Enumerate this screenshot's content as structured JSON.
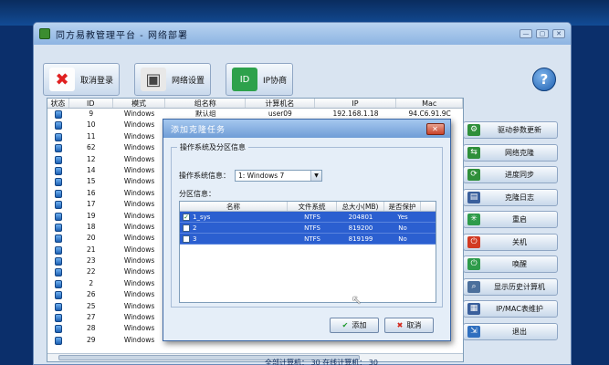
{
  "window": {
    "title": "同方易教管理平台 - 网络部署"
  },
  "toolbar": {
    "logout_label": "取消登录",
    "network_label": "网络设置",
    "ip_label": "IP协商",
    "ip_badge": "ID",
    "help_label": "?"
  },
  "table": {
    "headers": [
      "状态",
      "ID",
      "模式",
      "组名称",
      "计算机名",
      "IP",
      "Mac"
    ],
    "rows": [
      {
        "id": "9",
        "mode": "Windows",
        "group": "默认组",
        "pc": "user09",
        "ip": "192.168.1.18",
        "mac": "94.C6.91.9C"
      },
      {
        "id": "10",
        "mode": "Windows",
        "group": "",
        "pc": "",
        "ip": "",
        "mac": ""
      },
      {
        "id": "11",
        "mode": "Windows",
        "group": "",
        "pc": "",
        "ip": "",
        "mac": ""
      },
      {
        "id": "62",
        "mode": "Windows",
        "group": "",
        "pc": "",
        "ip": "",
        "mac": ""
      },
      {
        "id": "12",
        "mode": "Windows",
        "group": "",
        "pc": "",
        "ip": "",
        "mac": ""
      },
      {
        "id": "14",
        "mode": "Windows",
        "group": "",
        "pc": "",
        "ip": "",
        "mac": ""
      },
      {
        "id": "15",
        "mode": "Windows",
        "group": "",
        "pc": "",
        "ip": "",
        "mac": ""
      },
      {
        "id": "16",
        "mode": "Windows",
        "group": "",
        "pc": "",
        "ip": "",
        "mac": ""
      },
      {
        "id": "17",
        "mode": "Windows",
        "group": "",
        "pc": "",
        "ip": "",
        "mac": ""
      },
      {
        "id": "19",
        "mode": "Windows",
        "group": "",
        "pc": "",
        "ip": "",
        "mac": ""
      },
      {
        "id": "18",
        "mode": "Windows",
        "group": "",
        "pc": "",
        "ip": "",
        "mac": ""
      },
      {
        "id": "20",
        "mode": "Windows",
        "group": "",
        "pc": "",
        "ip": "",
        "mac": ""
      },
      {
        "id": "21",
        "mode": "Windows",
        "group": "",
        "pc": "",
        "ip": "",
        "mac": ""
      },
      {
        "id": "23",
        "mode": "Windows",
        "group": "",
        "pc": "",
        "ip": "",
        "mac": ""
      },
      {
        "id": "22",
        "mode": "Windows",
        "group": "",
        "pc": "",
        "ip": "",
        "mac": ""
      },
      {
        "id": "2",
        "mode": "Windows",
        "group": "",
        "pc": "",
        "ip": "",
        "mac": ""
      },
      {
        "id": "26",
        "mode": "Windows",
        "group": "",
        "pc": "",
        "ip": "",
        "mac": ""
      },
      {
        "id": "25",
        "mode": "Windows",
        "group": "",
        "pc": "",
        "ip": "",
        "mac": ""
      },
      {
        "id": "27",
        "mode": "Windows",
        "group": "",
        "pc": "",
        "ip": "",
        "mac": ""
      },
      {
        "id": "28",
        "mode": "Windows",
        "group": "",
        "pc": "",
        "ip": "",
        "mac": ""
      },
      {
        "id": "29",
        "mode": "Windows",
        "group": "",
        "pc": "",
        "ip": "",
        "mac": ""
      }
    ]
  },
  "side_buttons": [
    {
      "label": "驱动参数更新",
      "icon": "driver-update-icon",
      "color": "#2f8f3a",
      "glyph": "⚙"
    },
    {
      "label": "网络克隆",
      "icon": "network-clone-icon",
      "color": "#2f8f3a",
      "glyph": "⇆"
    },
    {
      "label": "进度同步",
      "icon": "progress-sync-icon",
      "color": "#2f8f3a",
      "glyph": "⟳"
    },
    {
      "label": "克隆日志",
      "icon": "clone-log-icon",
      "color": "#3a5f9c",
      "glyph": "▤"
    },
    {
      "label": "重启",
      "icon": "restart-icon",
      "color": "#2e9b4a",
      "glyph": "✳"
    },
    {
      "label": "关机",
      "icon": "shutdown-icon",
      "color": "#d23a22",
      "glyph": "⏻"
    },
    {
      "label": "唤醒",
      "icon": "wake-icon",
      "color": "#2e9b4a",
      "glyph": "⏻"
    },
    {
      "label": "显示历史计算机",
      "icon": "history-icon",
      "color": "#4b6f9c",
      "glyph": "⌕"
    },
    {
      "label": "IP/MAC表维护",
      "icon": "ip-mac-table-icon",
      "color": "#3a5f9c",
      "glyph": "▦"
    },
    {
      "label": "退出",
      "icon": "exit-icon",
      "color": "#2f6fbf",
      "glyph": "⇲"
    }
  ],
  "status": {
    "text": "全部计算机：  30         在线计算机：  30"
  },
  "dialog": {
    "title": "添加克隆任务",
    "close_label": "✕",
    "group_legend": "操作系统及分区信息",
    "os_label": "操作系统信息：",
    "os_value": "1: Windows 7",
    "partition_label": "分区信息：",
    "part_headers": [
      "名称",
      "文件系统",
      "总大小(MB)",
      "是否保护"
    ],
    "partitions": [
      {
        "name": "1_sys",
        "fs": "NTFS",
        "size": "204801",
        "protected": "Yes",
        "checked": "✓"
      },
      {
        "name": "2",
        "fs": "NTFS",
        "size": "819200",
        "protected": "No",
        "checked": ""
      },
      {
        "name": "3",
        "fs": "NTFS",
        "size": "819199",
        "protected": "No",
        "checked": ""
      }
    ],
    "add_label": "添加",
    "cancel_label": "取消"
  },
  "colors": {
    "desktop": "#0b2f6b",
    "selection": "#2b5fd0",
    "window_bg": "#d9e4f1"
  }
}
